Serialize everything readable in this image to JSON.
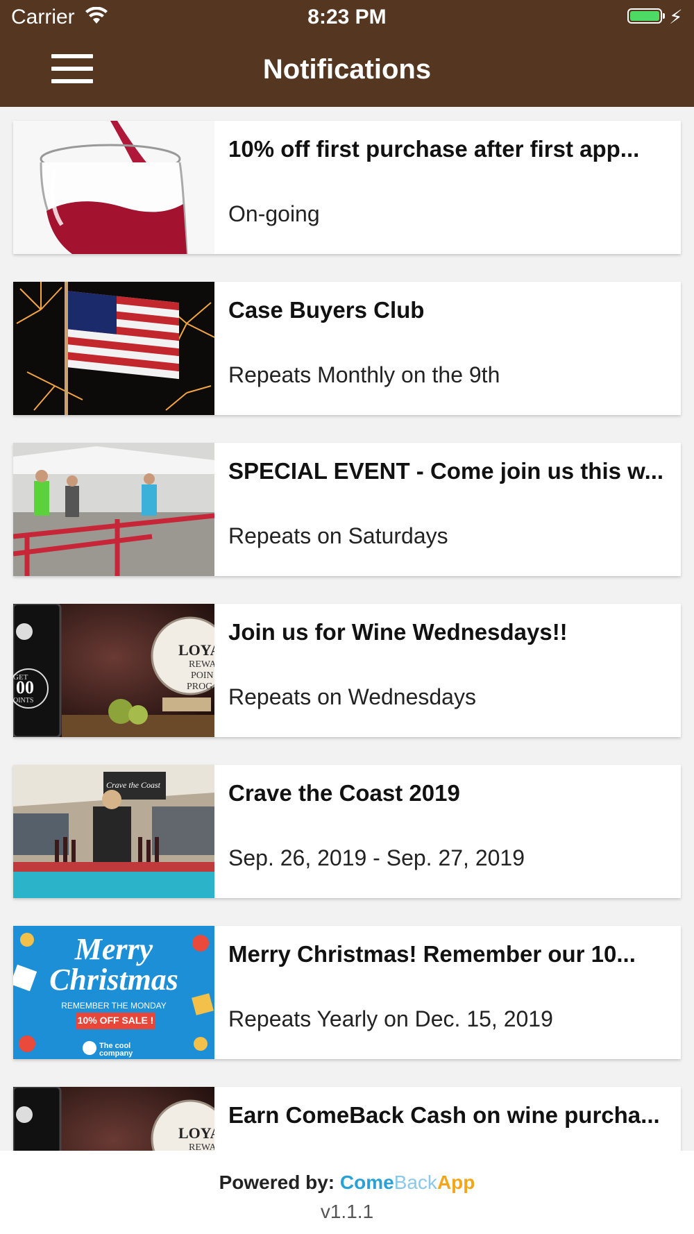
{
  "status_bar": {
    "carrier": "Carrier",
    "time": "8:23 PM",
    "battery_color": "#4cd964"
  },
  "header": {
    "title": "Notifications",
    "menu_icon": "hamburger-menu-icon",
    "background": "#553721"
  },
  "notifications": [
    {
      "title": "10% off first purchase after first app...",
      "subtitle": "On-going"
    },
    {
      "title": "Case Buyers Club",
      "subtitle": "Repeats Monthly on the 9th"
    },
    {
      "title": "SPECIAL EVENT - Come join us this w...",
      "subtitle": "Repeats on Saturdays"
    },
    {
      "title": "Join us for Wine Wednesdays!!",
      "subtitle": "Repeats on Wednesdays"
    },
    {
      "title": "Crave the Coast 2019",
      "subtitle": "Sep. 26, 2019 - Sep. 27, 2019"
    },
    {
      "title": "Merry Christmas! Remember our 10...",
      "subtitle": "Repeats Yearly on Dec. 15, 2019"
    },
    {
      "title": "Earn ComeBack Cash on wine purcha...",
      "subtitle": ""
    }
  ],
  "images": {
    "loyalty_badge": "LOYA",
    "loyalty_reward": "REWA",
    "loyalty_points": "POIN",
    "loyalty_program": "PROG",
    "get_label": "GET",
    "points_number": "00",
    "points_label": "OINTS",
    "crave_banner": "Crave the Coast",
    "xmas_line1": "Merry",
    "xmas_line2": "Christmas",
    "xmas_remember": "REMEMBER THE MONDAY",
    "xmas_sale": "10% OFF SALE !",
    "xmas_company": "The cool company"
  },
  "footer": {
    "powered_by": "Powered by:",
    "brand_part1": "Come",
    "brand_part2": "Back",
    "brand_part3": "App",
    "version": "v1.1.1"
  }
}
